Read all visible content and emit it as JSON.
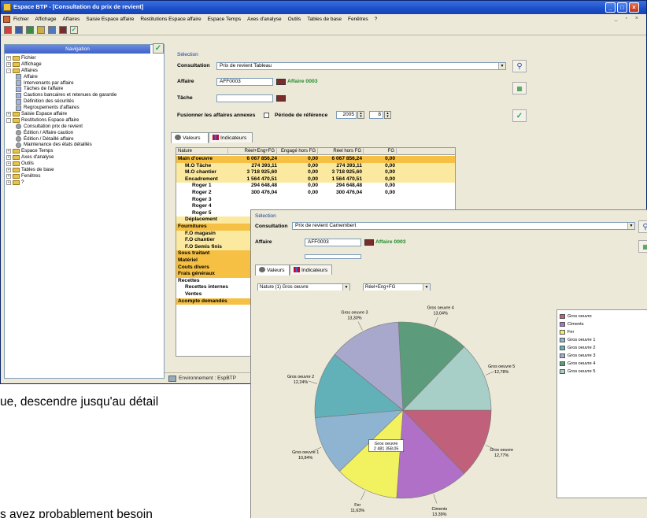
{
  "main_window": {
    "title": "Espace BTP - [Consultation du prix de revient]",
    "menu": [
      "Fichier",
      "Affichage",
      "Affaires",
      "Saisie Espace affaire",
      "Restitutions Espace affaire",
      "Espace Temps",
      "Axes d'analyse",
      "Outils",
      "Tables de base",
      "Fenêtres",
      "?"
    ],
    "nav": {
      "header": "Navigation",
      "tree": [
        {
          "label": "Fichier",
          "level": 0,
          "expander": "+"
        },
        {
          "label": "Affichage",
          "level": 0,
          "expander": "+"
        },
        {
          "label": "Affaires",
          "level": 0,
          "expander": "-"
        },
        {
          "label": "Affaire",
          "level": 1
        },
        {
          "label": "Intervenants par affaire",
          "level": 1
        },
        {
          "label": "Tâches de l'affaire",
          "level": 1
        },
        {
          "label": "Cautions bancaires et retenues de garantie",
          "level": 1
        },
        {
          "label": "Définition des sécurités",
          "level": 1
        },
        {
          "label": "Regroupements d'affaires",
          "level": 1
        },
        {
          "label": "Saisie Espace affaire",
          "level": 0,
          "expander": "+"
        },
        {
          "label": "Restitutions Espace affaire",
          "level": 0,
          "expander": "-"
        },
        {
          "label": "Consultation prix de revient",
          "level": 1
        },
        {
          "label": "Édition / Affaire caution",
          "level": 1
        },
        {
          "label": "Édition / Détaillé affaire",
          "level": 1
        },
        {
          "label": "Maintenance des états détaillés",
          "level": 1
        },
        {
          "label": "Espace Temps",
          "level": 0,
          "expander": "+"
        },
        {
          "label": "Axes d'analyse",
          "level": 0,
          "expander": "+"
        },
        {
          "label": "Outils",
          "level": 0,
          "expander": "+"
        },
        {
          "label": "Tables de base",
          "level": 0,
          "expander": "+"
        },
        {
          "label": "Fenêtres",
          "level": 0,
          "expander": "+"
        },
        {
          "label": "?",
          "level": 0,
          "expander": "+"
        }
      ]
    },
    "selection": {
      "title": "Sélection",
      "consultation_label": "Consultation",
      "consultation_value": "Prix de revient Tableau",
      "affaire_label": "Affaire",
      "affaire_value": "AFF0003",
      "affaire_name": "Affaire 0003",
      "tache_label": "Tâche",
      "tache_value": "",
      "fusion_label": "Fusionner les affaires annexes",
      "periode_label": "Période de référence",
      "year": "2005",
      "month": "8"
    },
    "tabs": [
      "Valeurs",
      "Indicateurs"
    ],
    "grid": {
      "columns": [
        "Nature",
        "Réel+Eng+FG",
        "Engagé hors FG",
        "Réel hors FG",
        "FG"
      ],
      "rows": [
        {
          "nature": "Main d'oeuvre",
          "reel": "6 067 856,24",
          "eng": "0,00",
          "rhf": "6 067 856,24",
          "fg": "0,00",
          "style": "main",
          "indent": 0
        },
        {
          "nature": "M.O Tâche",
          "reel": "274 393,11",
          "eng": "0,00",
          "rhf": "274 393,11",
          "fg": "0,00",
          "style": "sub",
          "indent": 1
        },
        {
          "nature": "M.O chantier",
          "reel": "3 718 925,60",
          "eng": "0,00",
          "rhf": "3 718 925,60",
          "fg": "0,00",
          "style": "sub",
          "indent": 1
        },
        {
          "nature": "Encadrement",
          "reel": "1 564 470,51",
          "eng": "0,00",
          "rhf": "1 564 470,51",
          "fg": "0,00",
          "style": "sub",
          "indent": 1
        },
        {
          "nature": "Roger 1",
          "reel": "294 648,48",
          "eng": "0,00",
          "rhf": "294 648,48",
          "fg": "0,00",
          "style": "plain",
          "indent": 2
        },
        {
          "nature": "Roger 2",
          "reel": "300 476,04",
          "eng": "0,00",
          "rhf": "300 476,04",
          "fg": "0,00",
          "style": "plain",
          "indent": 2
        },
        {
          "nature": "Roger 3",
          "reel": "",
          "eng": "",
          "rhf": "",
          "fg": "",
          "style": "plain",
          "indent": 2
        },
        {
          "nature": "Roger 4",
          "reel": "",
          "eng": "",
          "rhf": "",
          "fg": "",
          "style": "plain",
          "indent": 2
        },
        {
          "nature": "Roger 5",
          "reel": "",
          "eng": "",
          "rhf": "",
          "fg": "",
          "style": "plain",
          "indent": 2
        },
        {
          "nature": "Déplacement",
          "reel": "",
          "eng": "",
          "rhf": "",
          "fg": "",
          "style": "sub",
          "indent": 1
        },
        {
          "nature": "Fournitures",
          "reel": "",
          "eng": "",
          "rhf": "",
          "fg": "",
          "style": "main",
          "indent": 0
        },
        {
          "nature": "F.O magasin",
          "reel": "",
          "eng": "",
          "rhf": "",
          "fg": "",
          "style": "sub",
          "indent": 1
        },
        {
          "nature": "F.O chantier",
          "reel": "",
          "eng": "",
          "rhf": "",
          "fg": "",
          "style": "sub",
          "indent": 1
        },
        {
          "nature": "F.O Semis finis",
          "reel": "",
          "eng": "",
          "rhf": "",
          "fg": "",
          "style": "sub",
          "indent": 1
        },
        {
          "nature": "Sous traitant",
          "reel": "",
          "eng": "",
          "rhf": "",
          "fg": "",
          "style": "main",
          "indent": 0
        },
        {
          "nature": "Matériel",
          "reel": "",
          "eng": "",
          "rhf": "",
          "fg": "",
          "style": "main",
          "indent": 0
        },
        {
          "nature": "Couts divers",
          "reel": "",
          "eng": "",
          "rhf": "",
          "fg": "",
          "style": "main",
          "indent": 0
        },
        {
          "nature": "Frais généraux",
          "reel": "",
          "eng": "",
          "rhf": "",
          "fg": "",
          "style": "main",
          "indent": 0
        },
        {
          "nature": "Recettes",
          "reel": "",
          "eng": "",
          "rhf": "",
          "fg": "",
          "style": "plain",
          "indent": 0
        },
        {
          "nature": "Recettes internes",
          "reel": "",
          "eng": "",
          "rhf": "",
          "fg": "",
          "style": "plain",
          "indent": 1
        },
        {
          "nature": "Ventes",
          "reel": "",
          "eng": "",
          "rhf": "",
          "fg": "",
          "style": "plain",
          "indent": 1
        },
        {
          "nature": "Acompte demandés",
          "reel": "",
          "eng": "",
          "rhf": "",
          "fg": "",
          "style": "main",
          "indent": 0
        }
      ]
    },
    "status": "Environnement : EspBTP"
  },
  "background_text": {
    "line1": "ue, descendre jusqu'au détail",
    "line2": "s avez probablement besoin"
  },
  "second_window": {
    "selection_title": "Sélection",
    "consultation_label": "Consultation",
    "consultation_value": "Prix de revient Camembert",
    "affaire_label": "Affaire",
    "affaire_value": "AFF0003",
    "affaire_name": "Affaire 0003",
    "tabs": [
      "Valeurs",
      "Indicateurs"
    ],
    "dropdown_nature": "Nature (1) Gros oeuvre",
    "dropdown_measure": "Réel+Eng+FG"
  },
  "chart_data": {
    "type": "pie",
    "labels": [
      "Gros oeuvre",
      "Ciments",
      "Fer",
      "Gros oeuvre 1",
      "Gros oeuvre 2",
      "Gros oeuvre 3",
      "Gros oeuvre 4",
      "Gros oeuvre 5"
    ],
    "values": [
      12.77,
      13.39,
      11.63,
      10.84,
      12.24,
      13.3,
      13.04,
      12.78
    ],
    "colors": [
      "#c0607a",
      "#b070c8",
      "#f2f260",
      "#8eb4d2",
      "#62b0b8",
      "#a8a8cc",
      "#5c9c7c",
      "#a8cec8"
    ],
    "callout_label": "Gros oeuvre",
    "callout_value": "2 481 358,05",
    "legend_position": "right"
  }
}
